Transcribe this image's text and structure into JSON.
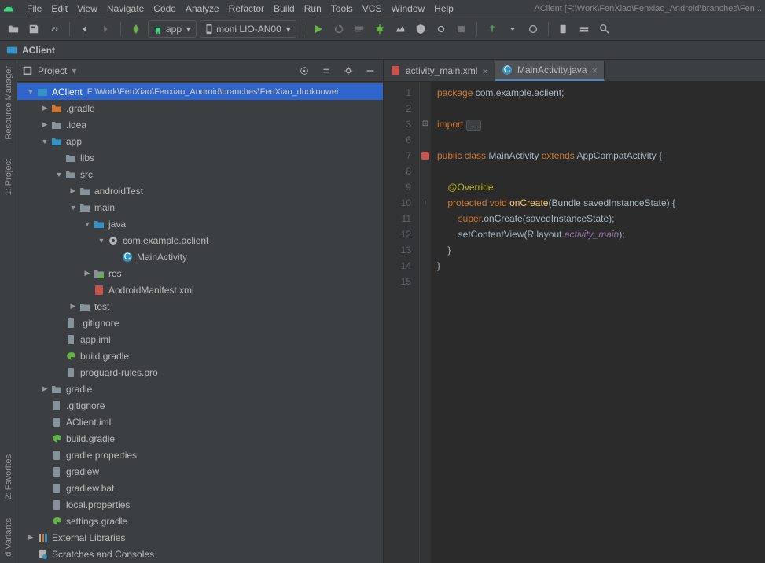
{
  "window_title": "AClient [F:\\Work\\FenXiao\\Fenxiao_Android\\branches\\Fen...",
  "menu": [
    "File",
    "Edit",
    "View",
    "Navigate",
    "Code",
    "Analyze",
    "Refactor",
    "Build",
    "Run",
    "Tools",
    "VCS",
    "Window",
    "Help"
  ],
  "run_config": "app",
  "device": "moni LIO-AN00",
  "breadcrumb": "AClient",
  "project_label": "Project",
  "left_tabs": [
    "Resource Manager",
    "1: Project",
    "2: Favorites",
    "d Variants"
  ],
  "tree": [
    {
      "d": 0,
      "a": "▼",
      "i": "proj",
      "t": "AClient",
      "p": "F:\\Work\\FenXiao\\Fenxiao_Android\\branches\\FenXiao_duokouwei",
      "sel": true
    },
    {
      "d": 1,
      "a": "▶",
      "i": "folder-o",
      "t": ".gradle"
    },
    {
      "d": 1,
      "a": "▶",
      "i": "folder",
      "t": ".idea"
    },
    {
      "d": 1,
      "a": "▼",
      "i": "folder-b",
      "t": "app"
    },
    {
      "d": 2,
      "a": "",
      "i": "folder",
      "t": "libs"
    },
    {
      "d": 2,
      "a": "▼",
      "i": "folder",
      "t": "src"
    },
    {
      "d": 3,
      "a": "▶",
      "i": "folder",
      "t": "androidTest"
    },
    {
      "d": 3,
      "a": "▼",
      "i": "folder",
      "t": "main"
    },
    {
      "d": 4,
      "a": "▼",
      "i": "folder-b",
      "t": "java"
    },
    {
      "d": 5,
      "a": "▼",
      "i": "pkg",
      "t": "com.example.aclient"
    },
    {
      "d": 6,
      "a": "",
      "i": "class",
      "t": "MainActivity"
    },
    {
      "d": 4,
      "a": "▶",
      "i": "folder-r",
      "t": "res"
    },
    {
      "d": 4,
      "a": "",
      "i": "xml",
      "t": "AndroidManifest.xml"
    },
    {
      "d": 3,
      "a": "▶",
      "i": "folder",
      "t": "test"
    },
    {
      "d": 2,
      "a": "",
      "i": "file",
      "t": ".gitignore"
    },
    {
      "d": 2,
      "a": "",
      "i": "file",
      "t": "app.iml"
    },
    {
      "d": 2,
      "a": "",
      "i": "gradle",
      "t": "build.gradle"
    },
    {
      "d": 2,
      "a": "",
      "i": "file",
      "t": "proguard-rules.pro"
    },
    {
      "d": 1,
      "a": "▶",
      "i": "folder",
      "t": "gradle"
    },
    {
      "d": 1,
      "a": "",
      "i": "file",
      "t": ".gitignore"
    },
    {
      "d": 1,
      "a": "",
      "i": "file",
      "t": "AClient.iml"
    },
    {
      "d": 1,
      "a": "",
      "i": "gradle",
      "t": "build.gradle"
    },
    {
      "d": 1,
      "a": "",
      "i": "file",
      "t": "gradle.properties"
    },
    {
      "d": 1,
      "a": "",
      "i": "file",
      "t": "gradlew"
    },
    {
      "d": 1,
      "a": "",
      "i": "file",
      "t": "gradlew.bat"
    },
    {
      "d": 1,
      "a": "",
      "i": "file",
      "t": "local.properties"
    },
    {
      "d": 1,
      "a": "",
      "i": "gradle",
      "t": "settings.gradle"
    },
    {
      "d": 0,
      "a": "▶",
      "i": "lib",
      "t": "External Libraries"
    },
    {
      "d": 0,
      "a": "",
      "i": "scratch",
      "t": "Scratches and Consoles"
    }
  ],
  "editor_tabs": [
    {
      "label": "activity_main.xml",
      "icon": "xml",
      "active": false
    },
    {
      "label": "MainActivity.java",
      "icon": "class",
      "active": true
    }
  ],
  "code": {
    "lines": 15,
    "l1_a": "package",
    "l1_b": " com.example.aclient;",
    "l3_a": "import",
    "l3_b": "...",
    "l7_a": "public",
    "l7_b": "class",
    "l7_c": " MainActivity ",
    "l7_d": "extends",
    "l7_e": " AppCompatActivity {",
    "l9": "@Override",
    "l10_a": "protected",
    "l10_b": "void",
    "l10_c": "onCreate",
    "l10_d": "(Bundle savedInstanceState) {",
    "l11_a": "super",
    "l11_b": ".onCreate(savedInstanceState);",
    "l12_a": "        setContentView(R.layout.",
    "l12_b": "activity_main",
    "l12_c": ");",
    "l13": "    }",
    "l14": "}"
  }
}
